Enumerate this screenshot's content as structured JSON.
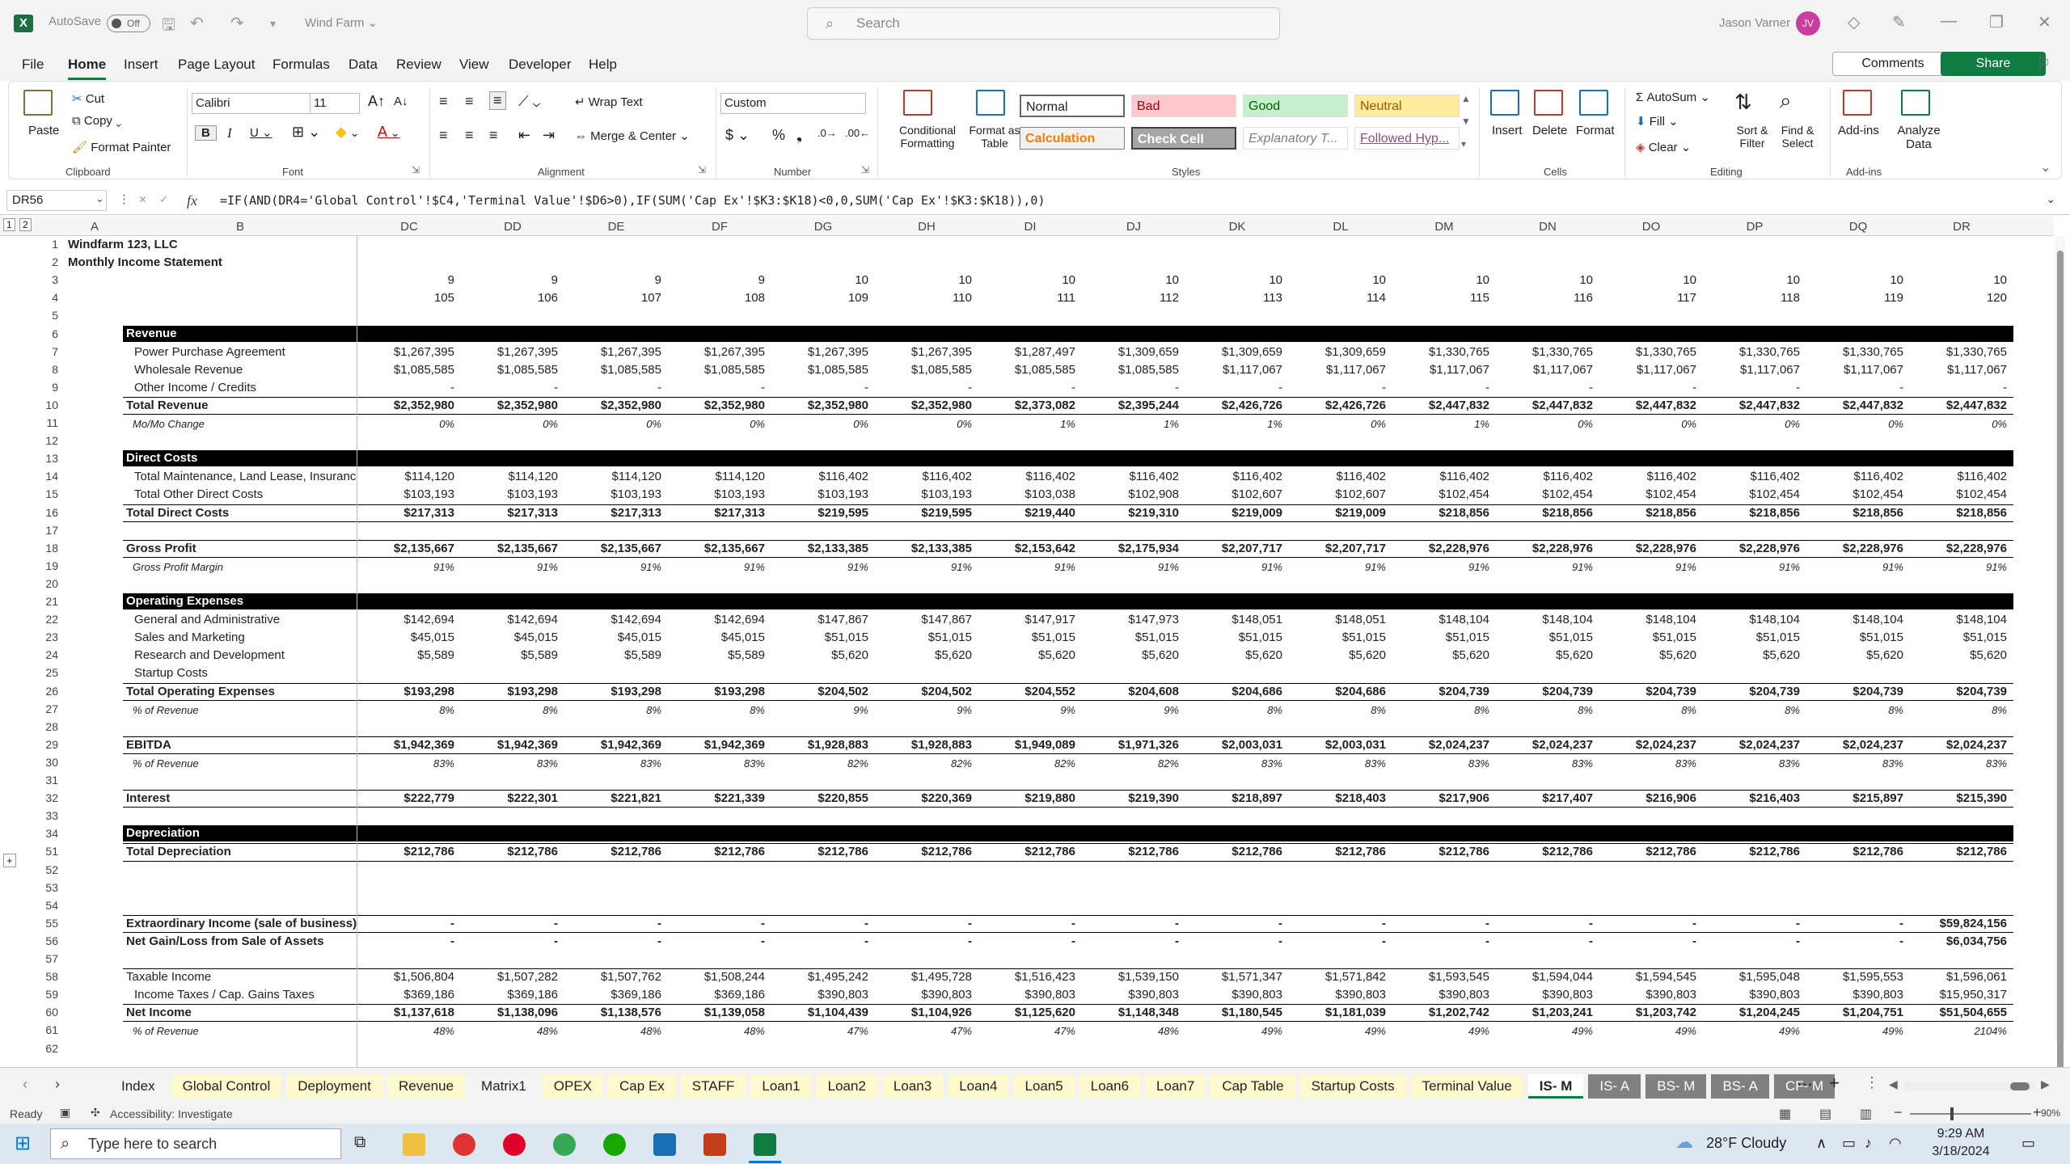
{
  "window": {
    "autosave_label": "AutoSave",
    "autosave_state": "Off",
    "doc_title": "Wind Farm ⌄",
    "search_placeholder": "Search",
    "user_name": "Jason Varner",
    "user_initials": "JV"
  },
  "menu": [
    "File",
    "Home",
    "Insert",
    "Page Layout",
    "Formulas",
    "Data",
    "Review",
    "View",
    "Developer",
    "Help"
  ],
  "menu_buttons": {
    "comments": "Comments",
    "share": "Share"
  },
  "ribbon": {
    "clipboard": {
      "paste": "Paste",
      "cut": "Cut",
      "copy": "Copy",
      "format_painter": "Format Painter",
      "label": "Clipboard"
    },
    "font": {
      "name": "Calibri",
      "size": "11",
      "label": "Font"
    },
    "alignment": {
      "wrap": "Wrap Text",
      "merge": "Merge & Center",
      "label": "Alignment"
    },
    "number": {
      "format": "Custom",
      "label": "Number"
    },
    "styles": {
      "cond": "Conditional Formatting",
      "table": "Format as Table",
      "label": "Styles",
      "cells": [
        {
          "text": "Normal",
          "bg": "#ffffff",
          "fg": "#000000"
        },
        {
          "text": "Bad",
          "bg": "#ffc7ce",
          "fg": "#9c0006"
        },
        {
          "text": "Good",
          "bg": "#c6efce",
          "fg": "#006100"
        },
        {
          "text": "Neutral",
          "bg": "#ffeb9c",
          "fg": "#9c5700"
        },
        {
          "text": "Calculation",
          "bg": "#f2f2f2",
          "fg": "#fa7d00"
        },
        {
          "text": "Check Cell",
          "bg": "#a5a5a5",
          "fg": "#ffffff"
        },
        {
          "text": "Explanatory T...",
          "bg": "#ffffff",
          "fg": "#7f7f7f"
        },
        {
          "text": "Followed Hyp...",
          "bg": "#ffffff",
          "fg": "#954f72"
        }
      ]
    },
    "cells": {
      "insert": "Insert",
      "delete": "Delete",
      "format": "Format",
      "label": "Cells"
    },
    "editing": {
      "autosum": "AutoSum",
      "fill": "Fill",
      "clear": "Clear",
      "sort": "Sort & Filter",
      "find": "Find & Select",
      "label": "Editing"
    },
    "addins": {
      "addins": "Add-ins",
      "analyze": "Analyze Data",
      "label": "Add-ins"
    }
  },
  "formula_bar": {
    "name_box": "DR56",
    "formula": "=IF(AND(DR4='Global Control'!$C4,'Terminal Value'!$D6>0),IF(SUM('Cap Ex'!$K3:$K18)<0,0,SUM('Cap Ex'!$K3:$K18)),0)"
  },
  "columns_fixed": [
    "A",
    "B"
  ],
  "columns": [
    "DC",
    "DD",
    "DE",
    "DF",
    "DG",
    "DH",
    "DI",
    "DJ",
    "DK",
    "DL",
    "DM",
    "DN",
    "DO",
    "DP",
    "DQ",
    "DR"
  ],
  "company": "Windfarm 123, LLC",
  "statement": "Monthly Income Statement",
  "years": [
    "9",
    "9",
    "9",
    "9",
    "10",
    "10",
    "10",
    "10",
    "10",
    "10",
    "10",
    "10",
    "10",
    "10",
    "10",
    "10"
  ],
  "months": [
    "105",
    "106",
    "107",
    "108",
    "109",
    "110",
    "111",
    "112",
    "113",
    "114",
    "115",
    "116",
    "117",
    "118",
    "119",
    "120"
  ],
  "rows": [
    {
      "r": "1"
    },
    {
      "r": "2"
    },
    {
      "r": "3"
    },
    {
      "r": "4"
    },
    {
      "r": "5"
    },
    {
      "r": "6",
      "label": "Revenue",
      "section": true
    },
    {
      "r": "7",
      "label": "Power Purchase Agreement",
      "indent": true,
      "vals": [
        "$1,267,395",
        "$1,267,395",
        "$1,267,395",
        "$1,267,395",
        "$1,267,395",
        "$1,267,395",
        "$1,287,497",
        "$1,309,659",
        "$1,309,659",
        "$1,309,659",
        "$1,330,765",
        "$1,330,765",
        "$1,330,765",
        "$1,330,765",
        "$1,330,765",
        "$1,330,765"
      ]
    },
    {
      "r": "8",
      "label": "Wholesale Revenue",
      "indent": true,
      "vals": [
        "$1,085,585",
        "$1,085,585",
        "$1,085,585",
        "$1,085,585",
        "$1,085,585",
        "$1,085,585",
        "$1,085,585",
        "$1,085,585",
        "$1,117,067",
        "$1,117,067",
        "$1,117,067",
        "$1,117,067",
        "$1,117,067",
        "$1,117,067",
        "$1,117,067",
        "$1,117,067"
      ]
    },
    {
      "r": "9",
      "label": "Other Income / Credits",
      "indent": true,
      "vals": [
        "-",
        "-",
        "-",
        "-",
        "-",
        "-",
        "-",
        "-",
        "-",
        "-",
        "-",
        "-",
        "-",
        "-",
        "-",
        "-"
      ]
    },
    {
      "r": "10",
      "label": "Total Revenue",
      "bold": true,
      "line": true,
      "vals": [
        "$2,352,980",
        "$2,352,980",
        "$2,352,980",
        "$2,352,980",
        "$2,352,980",
        "$2,352,980",
        "$2,373,082",
        "$2,395,244",
        "$2,426,726",
        "$2,426,726",
        "$2,447,832",
        "$2,447,832",
        "$2,447,832",
        "$2,447,832",
        "$2,447,832",
        "$2,447,832"
      ]
    },
    {
      "r": "11",
      "label": "Mo/Mo Change",
      "italic": true,
      "vals": [
        "0%",
        "0%",
        "0%",
        "0%",
        "0%",
        "0%",
        "1%",
        "1%",
        "1%",
        "0%",
        "1%",
        "0%",
        "0%",
        "0%",
        "0%",
        "0%"
      ]
    },
    {
      "r": "12"
    },
    {
      "r": "13",
      "label": "Direct Costs",
      "section": true
    },
    {
      "r": "14",
      "label": "Total Maintenance, Land Lease, Insurance",
      "indent": true,
      "vals": [
        "$114,120",
        "$114,120",
        "$114,120",
        "$114,120",
        "$116,402",
        "$116,402",
        "$116,402",
        "$116,402",
        "$116,402",
        "$116,402",
        "$116,402",
        "$116,402",
        "$116,402",
        "$116,402",
        "$116,402",
        "$116,402"
      ]
    },
    {
      "r": "15",
      "label": "Total Other Direct Costs",
      "indent": true,
      "vals": [
        "$103,193",
        "$103,193",
        "$103,193",
        "$103,193",
        "$103,193",
        "$103,193",
        "$103,038",
        "$102,908",
        "$102,607",
        "$102,607",
        "$102,454",
        "$102,454",
        "$102,454",
        "$102,454",
        "$102,454",
        "$102,454"
      ]
    },
    {
      "r": "16",
      "label": "Total Direct Costs",
      "bold": true,
      "line": true,
      "vals": [
        "$217,313",
        "$217,313",
        "$217,313",
        "$217,313",
        "$219,595",
        "$219,595",
        "$219,440",
        "$219,310",
        "$219,009",
        "$219,009",
        "$218,856",
        "$218,856",
        "$218,856",
        "$218,856",
        "$218,856",
        "$218,856"
      ]
    },
    {
      "r": "17"
    },
    {
      "r": "18",
      "label": "Gross Profit",
      "bold": true,
      "line": true,
      "vals": [
        "$2,135,667",
        "$2,135,667",
        "$2,135,667",
        "$2,135,667",
        "$2,133,385",
        "$2,133,385",
        "$2,153,642",
        "$2,175,934",
        "$2,207,717",
        "$2,207,717",
        "$2,228,976",
        "$2,228,976",
        "$2,228,976",
        "$2,228,976",
        "$2,228,976",
        "$2,228,976"
      ]
    },
    {
      "r": "19",
      "label": "Gross Profit Margin",
      "italic": true,
      "vals": [
        "91%",
        "91%",
        "91%",
        "91%",
        "91%",
        "91%",
        "91%",
        "91%",
        "91%",
        "91%",
        "91%",
        "91%",
        "91%",
        "91%",
        "91%",
        "91%"
      ]
    },
    {
      "r": "20"
    },
    {
      "r": "21",
      "label": "Operating Expenses",
      "section": true
    },
    {
      "r": "22",
      "label": "General and Administrative",
      "indent": true,
      "vals": [
        "$142,694",
        "$142,694",
        "$142,694",
        "$142,694",
        "$147,867",
        "$147,867",
        "$147,917",
        "$147,973",
        "$148,051",
        "$148,051",
        "$148,104",
        "$148,104",
        "$148,104",
        "$148,104",
        "$148,104",
        "$148,104"
      ]
    },
    {
      "r": "23",
      "label": "Sales and Marketing",
      "indent": true,
      "vals": [
        "$45,015",
        "$45,015",
        "$45,015",
        "$45,015",
        "$51,015",
        "$51,015",
        "$51,015",
        "$51,015",
        "$51,015",
        "$51,015",
        "$51,015",
        "$51,015",
        "$51,015",
        "$51,015",
        "$51,015",
        "$51,015"
      ]
    },
    {
      "r": "24",
      "label": "Research and Development",
      "indent": true,
      "vals": [
        "$5,589",
        "$5,589",
        "$5,589",
        "$5,589",
        "$5,620",
        "$5,620",
        "$5,620",
        "$5,620",
        "$5,620",
        "$5,620",
        "$5,620",
        "$5,620",
        "$5,620",
        "$5,620",
        "$5,620",
        "$5,620"
      ]
    },
    {
      "r": "25",
      "label": "Startup Costs",
      "indent": true
    },
    {
      "r": "26",
      "label": "Total Operating Expenses",
      "bold": true,
      "line": true,
      "vals": [
        "$193,298",
        "$193,298",
        "$193,298",
        "$193,298",
        "$204,502",
        "$204,502",
        "$204,552",
        "$204,608",
        "$204,686",
        "$204,686",
        "$204,739",
        "$204,739",
        "$204,739",
        "$204,739",
        "$204,739",
        "$204,739"
      ]
    },
    {
      "r": "27",
      "label": "% of Revenue",
      "italic": true,
      "vals": [
        "8%",
        "8%",
        "8%",
        "8%",
        "9%",
        "9%",
        "9%",
        "9%",
        "8%",
        "8%",
        "8%",
        "8%",
        "8%",
        "8%",
        "8%",
        "8%"
      ]
    },
    {
      "r": "28"
    },
    {
      "r": "29",
      "label": "EBITDA",
      "bold": true,
      "line": true,
      "vals": [
        "$1,942,369",
        "$1,942,369",
        "$1,942,369",
        "$1,942,369",
        "$1,928,883",
        "$1,928,883",
        "$1,949,089",
        "$1,971,326",
        "$2,003,031",
        "$2,003,031",
        "$2,024,237",
        "$2,024,237",
        "$2,024,237",
        "$2,024,237",
        "$2,024,237",
        "$2,024,237"
      ]
    },
    {
      "r": "30",
      "label": "% of Revenue",
      "italic": true,
      "vals": [
        "83%",
        "83%",
        "83%",
        "83%",
        "82%",
        "82%",
        "82%",
        "82%",
        "83%",
        "83%",
        "83%",
        "83%",
        "83%",
        "83%",
        "83%",
        "83%"
      ]
    },
    {
      "r": "31"
    },
    {
      "r": "32",
      "label": "Interest",
      "bold": true,
      "line": true,
      "vals": [
        "$222,779",
        "$222,301",
        "$221,821",
        "$221,339",
        "$220,855",
        "$220,369",
        "$219,880",
        "$219,390",
        "$218,897",
        "$218,403",
        "$217,906",
        "$217,407",
        "$216,906",
        "$216,403",
        "$215,897",
        "$215,390"
      ]
    },
    {
      "r": "33"
    },
    {
      "r": "34",
      "label": "Depreciation",
      "section": true
    },
    {
      "r": "51",
      "label": "Total Depreciation",
      "bold": true,
      "line": true,
      "vals": [
        "$212,786",
        "$212,786",
        "$212,786",
        "$212,786",
        "$212,786",
        "$212,786",
        "$212,786",
        "$212,786",
        "$212,786",
        "$212,786",
        "$212,786",
        "$212,786",
        "$212,786",
        "$212,786",
        "$212,786",
        "$212,786"
      ]
    },
    {
      "r": "52"
    },
    {
      "r": "53"
    },
    {
      "r": "54"
    },
    {
      "r": "55",
      "label": "Extraordinary Income (sale of business)",
      "bold": true,
      "line": true,
      "vals": [
        "-",
        "-",
        "-",
        "-",
        "-",
        "-",
        "-",
        "-",
        "-",
        "-",
        "-",
        "-",
        "-",
        "-",
        "-",
        "$59,824,156"
      ]
    },
    {
      "r": "56",
      "label": "Net Gain/Loss from Sale of Assets",
      "bold": true,
      "vals": [
        "-",
        "-",
        "-",
        "-",
        "-",
        "-",
        "-",
        "-",
        "-",
        "-",
        "-",
        "-",
        "-",
        "-",
        "-",
        "$6,034,756"
      ]
    },
    {
      "r": "57"
    },
    {
      "r": "58",
      "label": "Taxable Income",
      "line": true,
      "vals": [
        "$1,506,804",
        "$1,507,282",
        "$1,507,762",
        "$1,508,244",
        "$1,495,242",
        "$1,495,728",
        "$1,516,423",
        "$1,539,150",
        "$1,571,347",
        "$1,571,842",
        "$1,593,545",
        "$1,594,044",
        "$1,594,545",
        "$1,595,048",
        "$1,595,553",
        "$1,596,061"
      ]
    },
    {
      "r": "59",
      "label": "Income Taxes / Cap. Gains Taxes",
      "indent": true,
      "vals": [
        "$369,186",
        "$369,186",
        "$369,186",
        "$369,186",
        "$390,803",
        "$390,803",
        "$390,803",
        "$390,803",
        "$390,803",
        "$390,803",
        "$390,803",
        "$390,803",
        "$390,803",
        "$390,803",
        "$390,803",
        "$15,950,317"
      ]
    },
    {
      "r": "60",
      "label": "Net Income",
      "bold": true,
      "line": true,
      "vals": [
        "$1,137,618",
        "$1,138,096",
        "$1,138,576",
        "$1,139,058",
        "$1,104,439",
        "$1,104,926",
        "$1,125,620",
        "$1,148,348",
        "$1,180,545",
        "$1,181,039",
        "$1,202,742",
        "$1,203,241",
        "$1,203,742",
        "$1,204,245",
        "$1,204,751",
        "$51,504,655"
      ]
    },
    {
      "r": "61",
      "label": "% of Revenue",
      "italic": true,
      "vals": [
        "48%",
        "48%",
        "48%",
        "48%",
        "47%",
        "47%",
        "47%",
        "48%",
        "49%",
        "49%",
        "49%",
        "49%",
        "49%",
        "49%",
        "49%",
        "2104%"
      ]
    },
    {
      "r": "62"
    }
  ],
  "sheet_tabs": [
    {
      "name": "Index",
      "style": "plain"
    },
    {
      "name": "Global Control",
      "style": "ylw"
    },
    {
      "name": "Deployment",
      "style": "ylw"
    },
    {
      "name": "Revenue",
      "style": "ylw"
    },
    {
      "name": "Matrix1",
      "style": "plain"
    },
    {
      "name": "OPEX",
      "style": "ylw"
    },
    {
      "name": "Cap Ex",
      "style": "ylw"
    },
    {
      "name": "STAFF",
      "style": "ylw"
    },
    {
      "name": "Loan1",
      "style": "ylw"
    },
    {
      "name": "Loan2",
      "style": "ylw"
    },
    {
      "name": "Loan3",
      "style": "ylw"
    },
    {
      "name": "Loan4",
      "style": "ylw"
    },
    {
      "name": "Loan5",
      "style": "ylw"
    },
    {
      "name": "Loan6",
      "style": "ylw"
    },
    {
      "name": "Loan7",
      "style": "ylw"
    },
    {
      "name": "Cap Table",
      "style": "ylw"
    },
    {
      "name": "Startup Costs",
      "style": "ylw"
    },
    {
      "name": "Terminal Value",
      "style": "ylw"
    },
    {
      "name": "IS- M",
      "style": "active"
    },
    {
      "name": "IS- A",
      "style": "gray"
    },
    {
      "name": "BS- M",
      "style": "gray"
    },
    {
      "name": "BS- A",
      "style": "gray"
    },
    {
      "name": "CF- M",
      "style": "gray"
    }
  ],
  "status": {
    "ready": "Ready",
    "accessibility": "Accessibility: Investigate",
    "zoom": "90%"
  },
  "taskbar": {
    "search": "Type here to search",
    "weather": "28°F  Cloudy",
    "time": "9:29 AM",
    "date": "3/18/2024"
  },
  "colors": {
    "excel_green": "#107c41",
    "section_fill": "#000000",
    "tab_yellow": "#fffacd"
  }
}
